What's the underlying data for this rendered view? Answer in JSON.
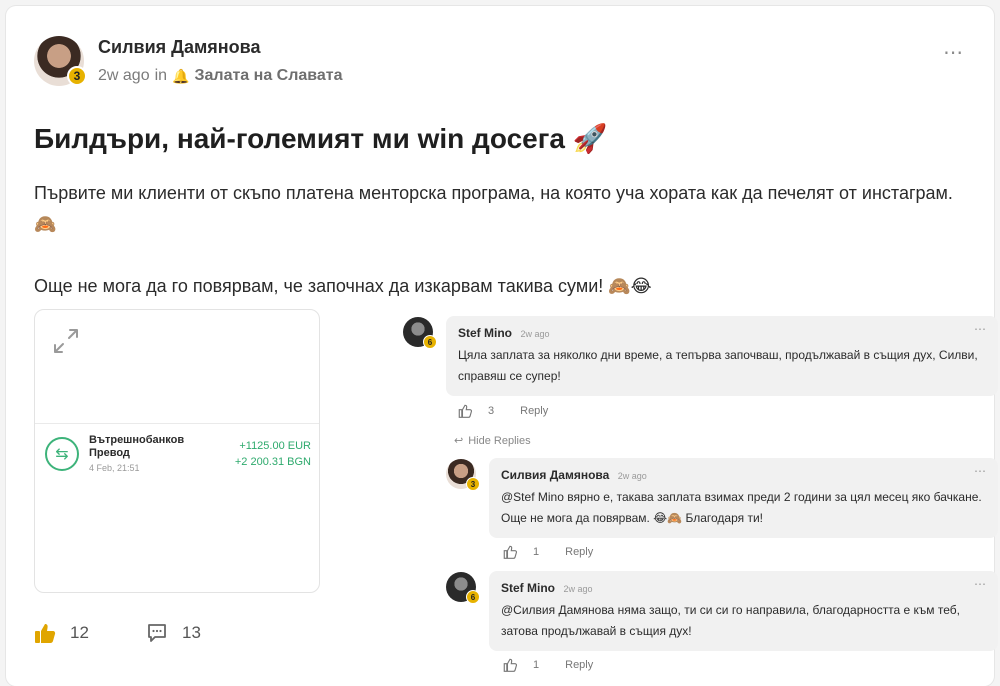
{
  "post": {
    "author": "Силвия Дамянова",
    "author_level": "3",
    "time": "2w ago",
    "in_word": "in",
    "category": "Залата на Славата",
    "category_icon": "bell-icon",
    "title": "Билдъри, най-големият ми win досега 🚀",
    "body_line1": "Първите ми клиенти от скъпо платена менторска програма, на която уча хората как да печелят от инстаграм. 🙈",
    "body_line2": "Още не мога да го повярвам, че започнах да изкарвам такива суми! 🙈😂",
    "likes": "12",
    "comments": "13"
  },
  "preview": {
    "tx_title": "Вътрешнобанков Превод",
    "tx_date": "4 Feb, 21:51",
    "tx_eur": "+1125.00 EUR",
    "tx_bgn": "+2 200.31 BGN"
  },
  "comments": [
    {
      "name": "Stef Mino",
      "time": "2w ago",
      "text": "Цяла заплата за няколко дни време, а тепърва започваш, продължавай в същия дух, Силви, справяш се супер!",
      "likes": "3",
      "reply_label": "Reply"
    }
  ],
  "hide_replies_label": "Hide Replies",
  "replies": [
    {
      "name": "Силвия Дамянова",
      "time": "2w ago",
      "mention": "@Stef Mino",
      "text": " вярно е, такава заплата взимах преди 2 години за цял месец яко бачкане. Още не мога да повярвам. 😂🙈 Благодаря ти!",
      "likes": "1",
      "reply_label": "Reply"
    },
    {
      "name": "Stef Mino",
      "time": "2w ago",
      "mention": "@Силвия Дамянова",
      "text": " няма защо, ти си си го направила, благодарността е към теб, затова продължавай в същия дух!",
      "likes": "1",
      "reply_label": "Reply"
    }
  ]
}
